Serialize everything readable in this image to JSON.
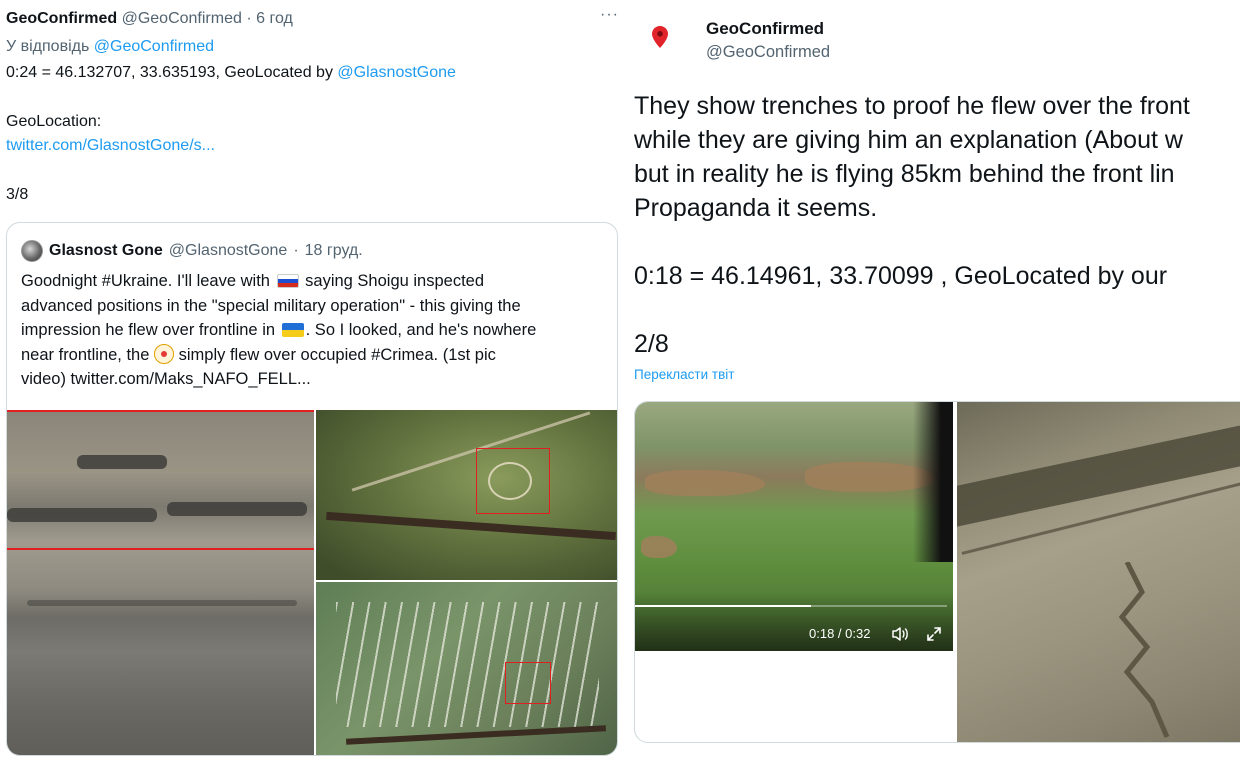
{
  "left_tweet": {
    "author_name": "GeoConfirmed",
    "author_handle": "@GeoConfirmed",
    "separator": "·",
    "time": "6 год",
    "more_icon": "more-dots-icon",
    "reply_prefix": "У відповідь",
    "reply_to": "@GeoConfirmed",
    "coords_text": "0:24 = 46.132707, 33.635193, GeoLocated by",
    "coords_credit": "@GlasnostGone",
    "geolocation_label": "GeoLocation:",
    "geolocation_link": "twitter.com/GlasnostGone/s...",
    "counter": "3/8"
  },
  "quote_tweet": {
    "author_name": "Glasnost Gone",
    "author_handle": "@GlasnostGone",
    "separator": "·",
    "time": "18 груд.",
    "line1_a": "Goodnight #Ukraine. I'll leave with",
    "line1_b": "saying Shoigu inspected",
    "line2": "advanced positions in the \"special military operation\" - this giving the",
    "line3_a": "impression he flew over frontline in",
    "line3_b": ". So I looked, and he's nowhere",
    "line4_a": "near frontline, the",
    "line4_b": "simply flew over occupied #Crimea. (1st pic",
    "line5": "video)  twitter.com/Maks_NAFO_FELL..."
  },
  "right_tweet": {
    "author_name": "GeoConfirmed",
    "author_handle": "@GeoConfirmed",
    "pin_icon": "location-pin-icon",
    "text_lines": [
      "They show trenches to proof he flew over the front",
      "while they are giving him an explanation (About w",
      "but in reality he is flying 85km behind the front lin",
      "Propaganda it seems."
    ],
    "coords_line": "0:18 = 46.14961, 33.70099 , GeoLocated by our",
    "counter": "2/8",
    "translate_label": "Перекласти твіт",
    "video": {
      "time_readout": "0:18 / 0:32",
      "progress": 0.5625,
      "volume_icon": "volume-icon",
      "expand_icon": "expand-icon"
    }
  },
  "colors": {
    "link": "#1d9bf0",
    "muted": "#536471",
    "text": "#0f1419",
    "pin": "#e0242a",
    "highlight_box": "#e02020"
  }
}
